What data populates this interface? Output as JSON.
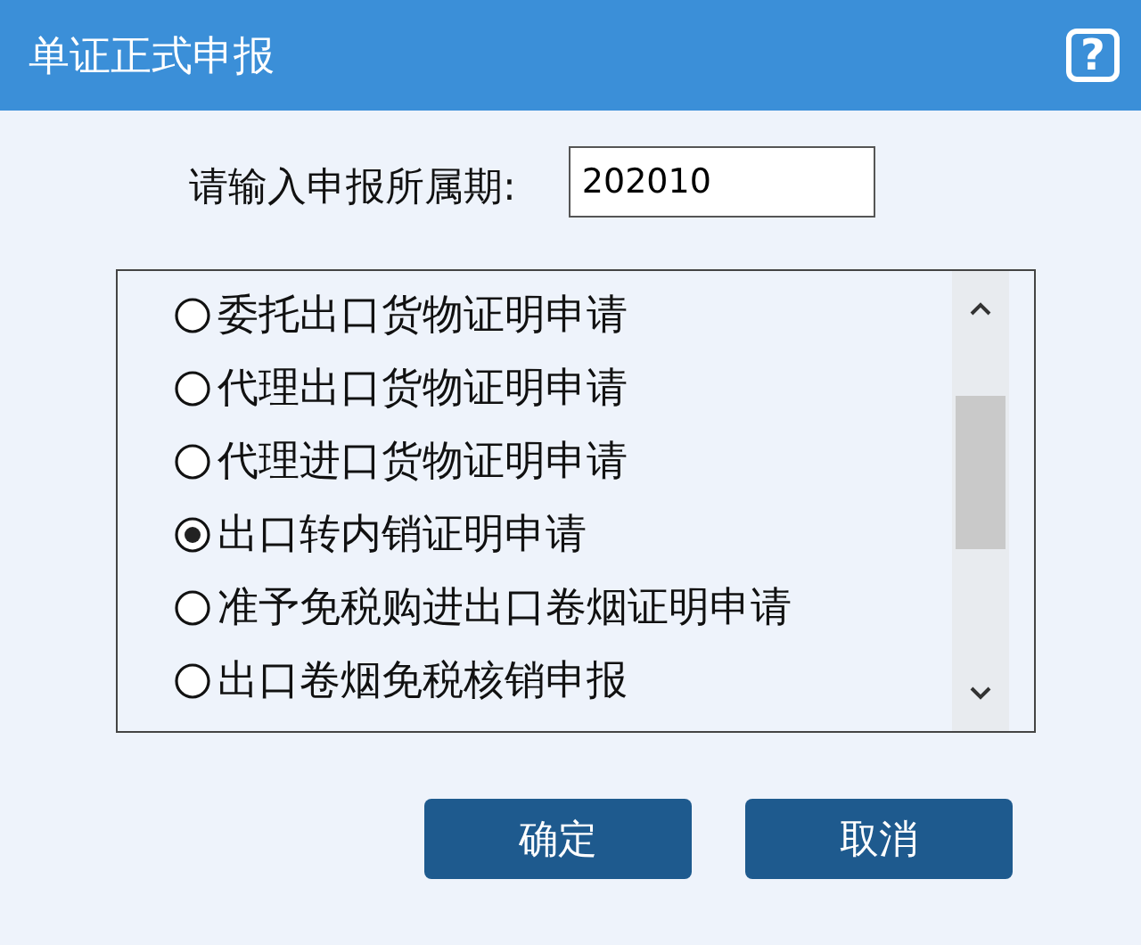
{
  "window": {
    "title": "单证正式申报",
    "help": "?"
  },
  "period": {
    "label": "请输入申报所属期:",
    "value": "202010"
  },
  "options": [
    {
      "label": "委托出口货物证明申请",
      "selected": false
    },
    {
      "label": "代理出口货物证明申请",
      "selected": false
    },
    {
      "label": "代理进口货物证明申请",
      "selected": false
    },
    {
      "label": "出口转内销证明申请",
      "selected": true
    },
    {
      "label": "准予免税购进出口卷烟证明申请",
      "selected": false
    },
    {
      "label": "出口卷烟免税核销申报",
      "selected": false
    }
  ],
  "buttons": [
    "确定",
    "取消"
  ]
}
